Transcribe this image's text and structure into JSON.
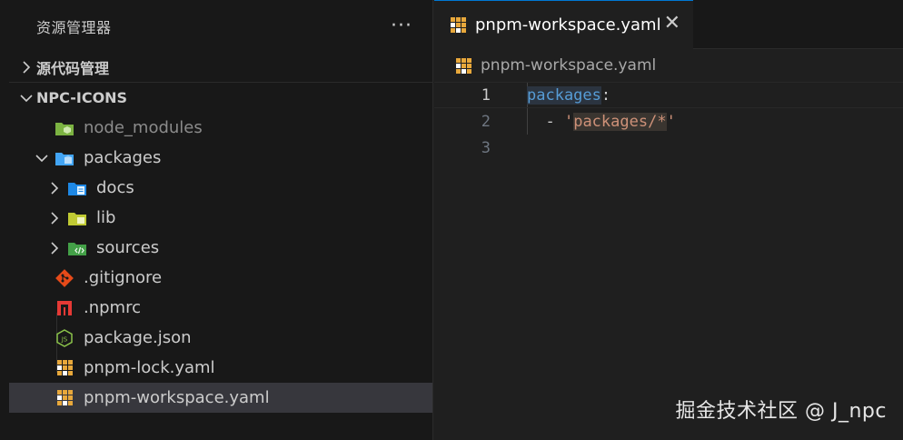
{
  "colors": {
    "accent": "#0078d4",
    "folder_green": "#7cb342",
    "folder_blue": "#42a5f5",
    "folder_yellow": "#cddc39",
    "git_orange": "#e64a19",
    "npm_red": "#e53935",
    "json_green": "#8bc34a",
    "yaml_orange": "#e8a83b"
  },
  "sidebar": {
    "title": "资源管理器",
    "more_label": "···",
    "scm_section": "源代码管理",
    "project_section": "NPC-ICONS",
    "tree": [
      {
        "label": "node_modules",
        "icon": "folder-node-icon",
        "depth": 1,
        "chevron": "none",
        "dim": true
      },
      {
        "label": "packages",
        "icon": "folder-packages-open-icon",
        "depth": 1,
        "chevron": "down"
      },
      {
        "label": "docs",
        "icon": "folder-docs-icon",
        "depth": 2,
        "chevron": "right"
      },
      {
        "label": "lib",
        "icon": "folder-lib-icon",
        "depth": 2,
        "chevron": "right"
      },
      {
        "label": "sources",
        "icon": "folder-src-icon",
        "depth": 2,
        "chevron": "right"
      },
      {
        "label": ".gitignore",
        "icon": "git-icon",
        "depth": 1,
        "chevron": "none"
      },
      {
        "label": ".npmrc",
        "icon": "npm-icon",
        "depth": 1,
        "chevron": "none"
      },
      {
        "label": "package.json",
        "icon": "nodejs-icon",
        "depth": 1,
        "chevron": "none"
      },
      {
        "label": "pnpm-lock.yaml",
        "icon": "yaml-icon",
        "depth": 1,
        "chevron": "none"
      },
      {
        "label": "pnpm-workspace.yaml",
        "icon": "yaml-icon",
        "depth": 1,
        "chevron": "none",
        "selected": true
      }
    ]
  },
  "editor": {
    "tab_label": "pnpm-workspace.yaml",
    "close_label": "✕",
    "breadcrumb_label": "pnpm-workspace.yaml",
    "lines": [
      {
        "number": "1",
        "key": "packages",
        "colon": ":"
      },
      {
        "number": "2",
        "indent": "  - ",
        "quote_open": "'",
        "string": "packages/*",
        "quote_close": "'"
      },
      {
        "number": "3"
      }
    ]
  },
  "watermark": "掘金技术社区 @ J_npc"
}
